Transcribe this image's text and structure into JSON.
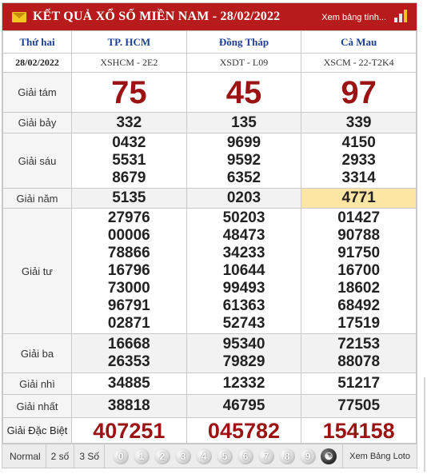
{
  "header": {
    "title": "KẾT QUẢ XỔ SỐ MIỀN NAM - 28/02/2022",
    "link": "Xem bảng tính...",
    "accent": "#b71b1b"
  },
  "day": "Thứ hai",
  "date": "28/02/2022",
  "provinces": [
    {
      "name": "TP. HCM",
      "code": "XSHCM - 2E2"
    },
    {
      "name": "Đồng Tháp",
      "code": "XSDT - L09"
    },
    {
      "name": "Cà Mau",
      "code": "XSCM - 22-T2K4"
    }
  ],
  "prizes": {
    "g8": {
      "label": "Giải tám",
      "values": [
        "75",
        "45",
        "97"
      ]
    },
    "g7": {
      "label": "Giải bảy",
      "values": [
        "332",
        "135",
        "339"
      ]
    },
    "g6": {
      "label": "Giải sáu",
      "values": [
        [
          "0432",
          "5531",
          "8679"
        ],
        [
          "9699",
          "9592",
          "6352"
        ],
        [
          "4150",
          "2933",
          "3314"
        ]
      ]
    },
    "g5": {
      "label": "Giải năm",
      "values": [
        "5135",
        "0203",
        "4771"
      ]
    },
    "g4": {
      "label": "Giải tư",
      "values": [
        [
          "27976",
          "00006",
          "78866",
          "16796",
          "73000",
          "96791",
          "02871"
        ],
        [
          "50203",
          "48473",
          "34233",
          "10644",
          "99493",
          "61363",
          "52743"
        ],
        [
          "01427",
          "90788",
          "91750",
          "16700",
          "18602",
          "68492",
          "17519"
        ]
      ]
    },
    "g3": {
      "label": "Giải ba",
      "values": [
        [
          "16668",
          "26353"
        ],
        [
          "95340",
          "79829"
        ],
        [
          "72153",
          "88078"
        ]
      ]
    },
    "g2": {
      "label": "Giải nhì",
      "values": [
        "34885",
        "12332",
        "51217"
      ]
    },
    "g1": {
      "label": "Giải nhất",
      "values": [
        "38818",
        "46795",
        "77505"
      ]
    },
    "gdb": {
      "label": "Giải Đặc Biệt",
      "values": [
        "407251",
        "045782",
        "154158"
      ]
    }
  },
  "footer": {
    "tabs": [
      "Normal",
      "2 số",
      "3 Số"
    ],
    "balls": [
      "0",
      "1",
      "2",
      "3",
      "4",
      "5",
      "6",
      "7",
      "8",
      "9"
    ],
    "link": "Xem Bảng Loto"
  }
}
